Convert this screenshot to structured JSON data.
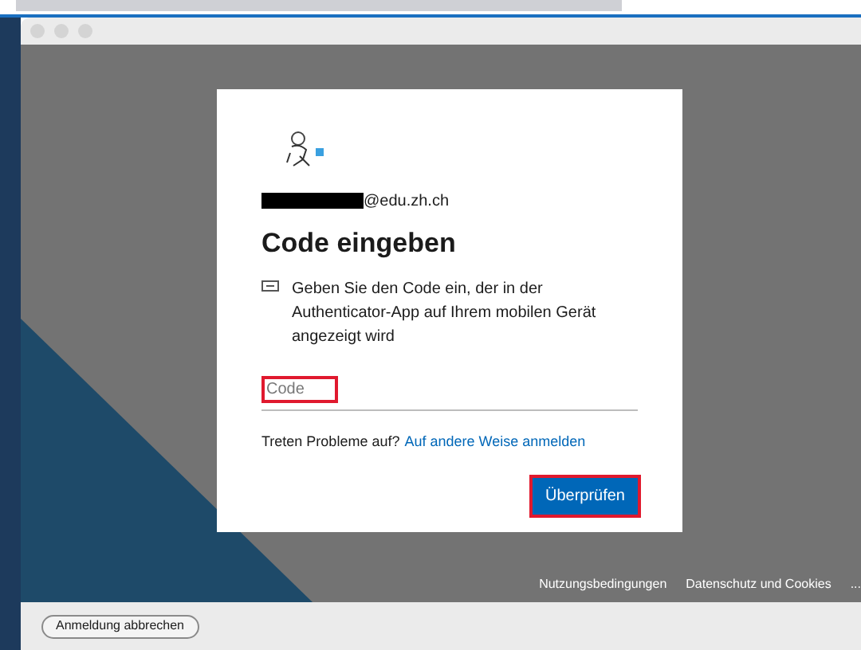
{
  "account": {
    "email_suffix": "@edu.zh.ch"
  },
  "heading": "Code eingeben",
  "instruction": "Geben Sie den Code ein, der in der Authenticator-App auf Ihrem mobilen Gerät angezeigt wird",
  "code_field": {
    "placeholder": "Code"
  },
  "help": {
    "text": "Treten Probleme auf?",
    "link": "Auf andere Weise anmelden"
  },
  "verify_button": "Überprüfen",
  "footer_links": [
    "Nutzungsbedingungen",
    "Datenschutz und Cookies",
    "..."
  ],
  "cancel_button": "Anmeldung abbrechen"
}
